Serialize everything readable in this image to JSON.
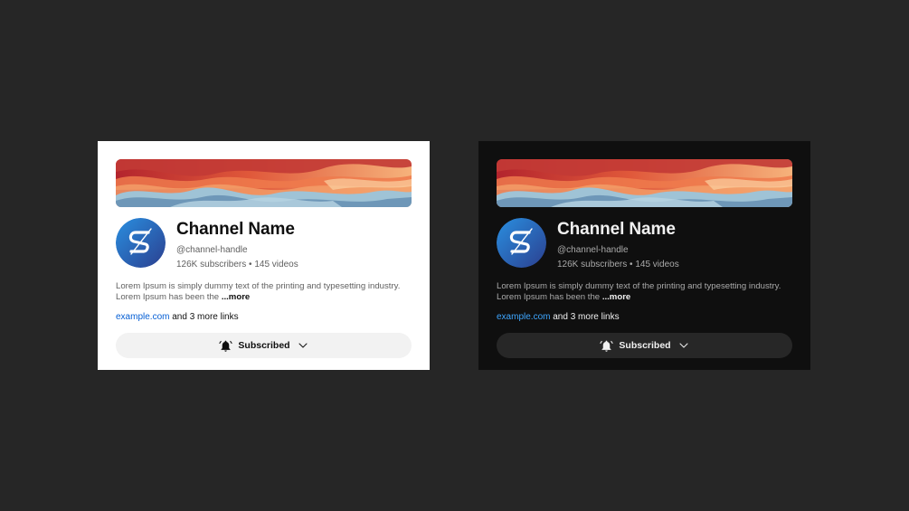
{
  "cards": {
    "light": {
      "channel_name": "Channel Name",
      "handle": "@channel-handle",
      "stats": "126K subscribers • 145 videos",
      "description": "Lorem Ipsum is simply dummy text of the printing and typesetting industry. Lorem Ipsum has been the",
      "more_label": "...more",
      "link_text": "example.com",
      "links_suffix": "and 3 more links",
      "subscribe_label": "Subscribed"
    },
    "dark": {
      "channel_name": "Channel Name",
      "handle": "@channel-handle",
      "stats": "126K subscribers • 145 videos",
      "description": "Lorem Ipsum is simply dummy text of the printing and typesetting industry. Lorem Ipsum has been the",
      "more_label": "...more",
      "link_text": "example.com",
      "links_suffix": "and 3 more links",
      "subscribe_label": "Subscribed"
    }
  },
  "icons": {
    "avatar_logo": "s-logo-icon",
    "bell": "bell-icon",
    "chevron": "chevron-down-icon"
  },
  "colors": {
    "page_background": "#262626",
    "light_card": "#ffffff",
    "dark_card": "#0f0f0f",
    "link_light": "#065fd4",
    "link_dark": "#3ea6ff",
    "avatar_blue": "#1f7fd6"
  }
}
